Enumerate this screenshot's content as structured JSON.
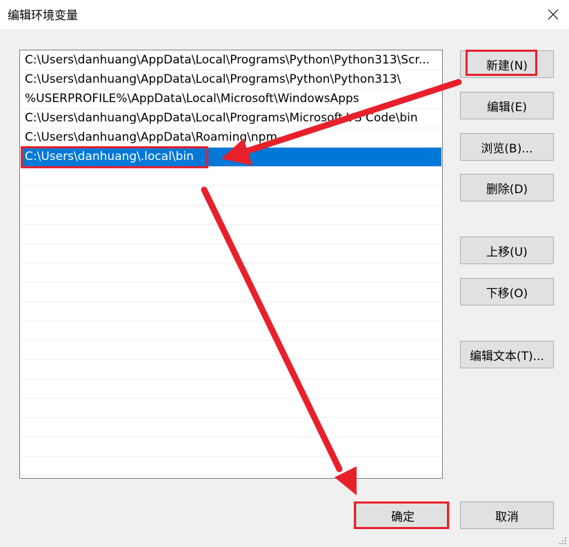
{
  "window": {
    "title": "编辑环境变量",
    "close_icon": "close-icon"
  },
  "env_list": {
    "items": [
      {
        "text": "C:\\Users\\danhuang\\AppData\\Local\\Programs\\Python\\Python313\\Scr...",
        "selected": false
      },
      {
        "text": "C:\\Users\\danhuang\\AppData\\Local\\Programs\\Python\\Python313\\",
        "selected": false
      },
      {
        "text": "%USERPROFILE%\\AppData\\Local\\Microsoft\\WindowsApps",
        "selected": false
      },
      {
        "text": "C:\\Users\\danhuang\\AppData\\Local\\Programs\\Microsoft VS Code\\bin",
        "selected": false
      },
      {
        "text": "C:\\Users\\danhuang\\AppData\\Roaming\\npm",
        "selected": false
      },
      {
        "text": "C:\\Users\\danhuang\\.local\\bin",
        "selected": true
      }
    ],
    "selected_color": "#0078d7"
  },
  "buttons": {
    "new": "新建(N)",
    "edit": "编辑(E)",
    "browse": "浏览(B)...",
    "delete": "删除(D)",
    "move_up": "上移(U)",
    "move_down": "下移(O)",
    "edit_text": "编辑文本(T)...",
    "ok": "确定",
    "cancel": "取消"
  },
  "annotations": {
    "highlight_color": "#e8202b"
  }
}
